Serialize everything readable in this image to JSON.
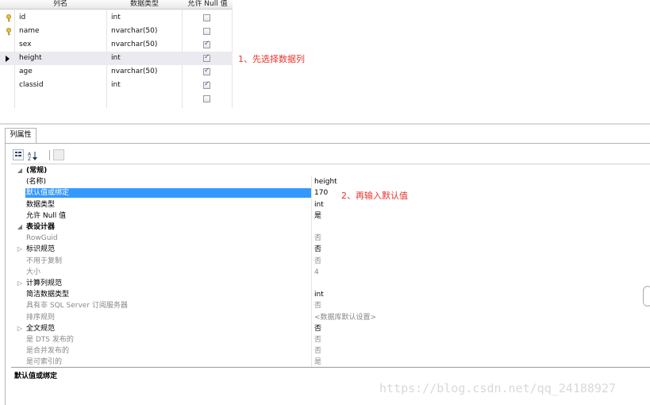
{
  "grid": {
    "headers": [
      "列名",
      "数据类型",
      "允许 Null 值"
    ],
    "rows": [
      {
        "name": "id",
        "type": "int",
        "allow_null": false,
        "key": true,
        "selected": false
      },
      {
        "name": "name",
        "type": "nvarchar(50)",
        "allow_null": false,
        "key": true,
        "selected": false
      },
      {
        "name": "sex",
        "type": "nvarchar(50)",
        "allow_null": true,
        "key": false,
        "selected": false
      },
      {
        "name": "height",
        "type": "int",
        "allow_null": true,
        "key": false,
        "selected": true
      },
      {
        "name": "age",
        "type": "nvarchar(50)",
        "allow_null": true,
        "key": false,
        "selected": false
      },
      {
        "name": "classid",
        "type": "int",
        "allow_null": true,
        "key": false,
        "selected": false
      },
      {
        "name": "",
        "type": "",
        "allow_null": false,
        "key": false,
        "selected": false
      }
    ]
  },
  "annotations": {
    "step1": "1、先选择数据列",
    "step2": "2、再输入默认值"
  },
  "properties": {
    "tab_label": "列属性",
    "rows": [
      {
        "kind": "cat",
        "expander": "◢",
        "name": "(常规)",
        "value": ""
      },
      {
        "kind": "item",
        "name": "(名称)",
        "value": "height"
      },
      {
        "kind": "sel",
        "name": "默认值或绑定",
        "value": "170"
      },
      {
        "kind": "item",
        "name": "数据类型",
        "value": "int"
      },
      {
        "kind": "item",
        "name": "允许 Null 值",
        "value": "是"
      },
      {
        "kind": "cat",
        "expander": "◢",
        "name": "表设计器",
        "value": ""
      },
      {
        "kind": "gray",
        "name": "RowGuid",
        "value": "否"
      },
      {
        "kind": "item",
        "expander": "▷",
        "name": "标识规范",
        "value": "否"
      },
      {
        "kind": "gray",
        "name": "不用于复制",
        "value": "否"
      },
      {
        "kind": "gray",
        "name": "大小",
        "value": "4"
      },
      {
        "kind": "item",
        "expander": "▷",
        "name": "计算列规范",
        "value": ""
      },
      {
        "kind": "item",
        "name": "简洁数据类型",
        "value": "int"
      },
      {
        "kind": "gray",
        "name": "具有非 SQL Server 订阅服务器",
        "value": "否"
      },
      {
        "kind": "gray",
        "name": "排序规则",
        "value": "<数据库默认设置>"
      },
      {
        "kind": "item",
        "expander": "▷",
        "name": "全文规范",
        "value": "否"
      },
      {
        "kind": "gray",
        "name": "是 DTS 发布的",
        "value": "否"
      },
      {
        "kind": "gray",
        "name": "是合并发布的",
        "value": "否"
      },
      {
        "kind": "gray",
        "name": "是可索引的",
        "value": "是"
      }
    ],
    "description_title": "默认值或绑定"
  },
  "watermark": "https://blog.csdn.net/qq_24188927",
  "colors": {
    "accent": "#3399ff",
    "annotation": "#e8342a"
  }
}
